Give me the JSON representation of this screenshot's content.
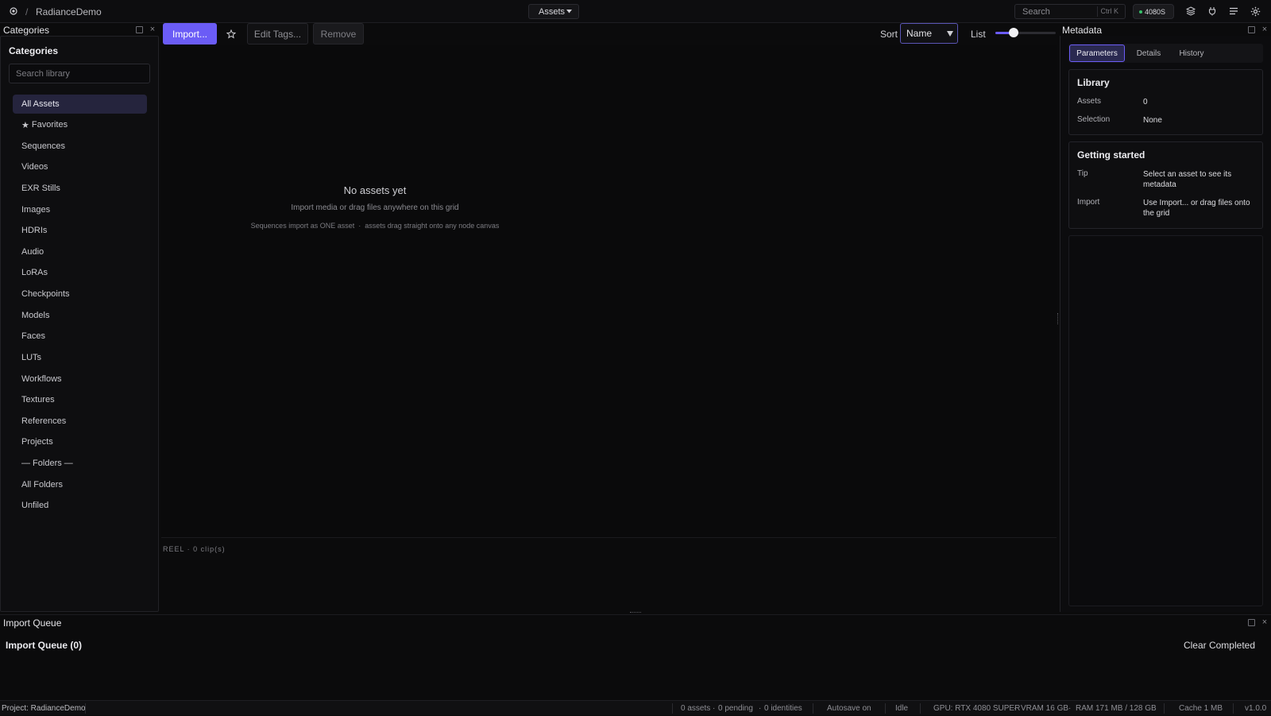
{
  "topbar": {
    "project_name": "RadianceDemo",
    "workspace_dropdown": "Assets",
    "search_placeholder": "Search",
    "search_shortcut": "Ctrl K",
    "gpu_badge": "4080S"
  },
  "categories_panel": {
    "title": "Categories",
    "heading": "Categories",
    "search_placeholder": "Search library",
    "items": [
      {
        "label": "All Assets"
      },
      {
        "label": "Favorites"
      },
      {
        "label": "Sequences"
      },
      {
        "label": "Videos"
      },
      {
        "label": "EXR Stills"
      },
      {
        "label": "Images"
      },
      {
        "label": "HDRIs"
      },
      {
        "label": "Audio"
      },
      {
        "label": "LoRAs"
      },
      {
        "label": "Checkpoints"
      },
      {
        "label": "Models"
      },
      {
        "label": "Faces"
      },
      {
        "label": "LUTs"
      },
      {
        "label": "Workflows"
      },
      {
        "label": "Textures"
      },
      {
        "label": "References"
      },
      {
        "label": "Projects"
      },
      {
        "label": "— Folders —"
      },
      {
        "label": "All Folders"
      },
      {
        "label": "Unfiled"
      }
    ]
  },
  "toolbar": {
    "import_label": "Import...",
    "edit_tags_label": "Edit Tags...",
    "remove_label": "Remove",
    "sort_label": "Sort",
    "sort_value": "Name",
    "view_label": "List",
    "size_slider_fraction": 0.3
  },
  "grid": {
    "empty_title": "No assets yet",
    "empty_subtitle": "Import media or drag files anywhere on this grid",
    "empty_hint": "Sequences import as ONE asset  ·  assets drag straight onto any node canvas",
    "reel_label": "REEL · 0 clip(s)"
  },
  "metadata_panel": {
    "title": "Metadata",
    "tabs": [
      {
        "label": "Parameters"
      },
      {
        "label": "Details"
      },
      {
        "label": "History"
      }
    ],
    "library": {
      "heading": "Library",
      "rows": [
        {
          "key": "Assets",
          "value": "0"
        },
        {
          "key": "Selection",
          "value": "None"
        }
      ]
    },
    "getting_started": {
      "heading": "Getting started",
      "rows": [
        {
          "key": "Tip",
          "value": "Select an asset to see its metadata"
        },
        {
          "key": "Import",
          "value": "Use Import... or drag files onto the grid"
        }
      ]
    }
  },
  "import_queue": {
    "title": "Import Queue",
    "heading": "Import Queue (0)",
    "clear_label": "Clear Completed"
  },
  "statusbar": {
    "project": "Project: RadianceDemo",
    "assets": "0 assets",
    "pending": "0 pending",
    "identities": "0 identities",
    "autosave": "Autosave on",
    "state": "Idle",
    "gpu": "GPU: RTX 4080 SUPER",
    "vram": "VRAM 16 GB",
    "ram": "RAM 171 MB / 128 GB",
    "cache": "Cache 1 MB",
    "version": "v1.0.0"
  },
  "colors": {
    "accent": "#6b5cf6",
    "active_item_bg": "#25243d",
    "gpu_dot": "#37c06a"
  }
}
